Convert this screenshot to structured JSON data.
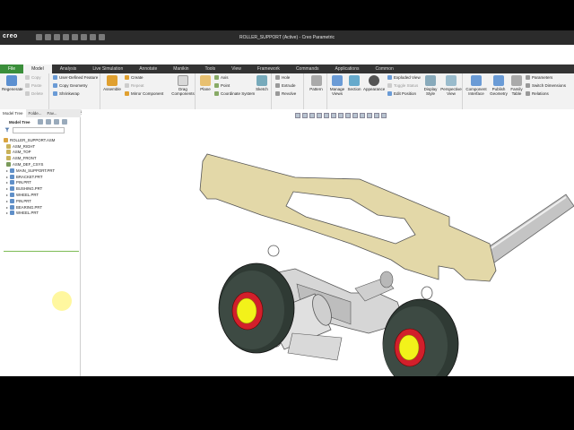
{
  "window": {
    "logo": "creo",
    "title": "ROLLER_SUPPORT (Active) - Creo Parametric"
  },
  "tabs": [
    "File",
    "Model",
    "Analysis",
    "Live Simulation",
    "Annotate",
    "Manikin",
    "Tools",
    "View",
    "Framework",
    "Commands",
    "Applications",
    "Common"
  ],
  "ribbon": {
    "operations": {
      "regenerate": "Regenerate",
      "copy": "Copy",
      "paste": "Paste",
      "delete": "Delete",
      "label": "Operations"
    },
    "get_data": {
      "udf": "User-Defined Feature",
      "copy_geometry": "Copy Geometry",
      "shrinkwrap": "Shrinkwrap",
      "label": "Get Data"
    },
    "component": {
      "assemble": "Assemble",
      "create": "Create",
      "repeat": "Repeat",
      "mirror": "Mirror Component",
      "drag": "Drag Components",
      "label": "Component"
    },
    "datum": {
      "plane": "Plane",
      "axis": "Axis",
      "point": "Point",
      "csys": "Coordinate System",
      "sketch": "Sketch",
      "label": "Datum"
    },
    "cut_surface": {
      "hole": "Hole",
      "extrude": "Extrude",
      "revolve": "Revolve",
      "label": "Cut & Surface"
    },
    "modifiers": {
      "pattern": "Pattern",
      "label": "Modifiers"
    },
    "model_display": {
      "manage_views": "Manage Views",
      "section": "Section",
      "appearance": "Appearance",
      "exploded": "Exploded View",
      "toggle_status": "Toggle Status",
      "edit_position": "Edit Position",
      "display_style": "Display Style",
      "perspective": "Perspective View",
      "label": "Model Display"
    },
    "model_intent": {
      "component_interface": "Component Interface",
      "publish_geometry": "Publish Geometry",
      "family_table": "Family Table",
      "parameters": "Parameters",
      "switch_dimensions": "Switch Dimensions",
      "relations": "Relations",
      "label": "Model Intent"
    }
  },
  "panel": {
    "tabs": [
      "Model Tree",
      "Folde...",
      "Fav..."
    ],
    "tree_label": "Model Tree",
    "search_placeholder": ""
  },
  "tree": [
    {
      "label": "ROLLER_SUPPORT.ASM",
      "icon": "assembly-icon",
      "indent": 0
    },
    {
      "label": "ASM_RIGHT",
      "icon": "datum-plane-icon",
      "indent": 1
    },
    {
      "label": "ASM_TOP",
      "icon": "datum-plane-icon",
      "indent": 1
    },
    {
      "label": "ASM_FRONT",
      "icon": "datum-plane-icon",
      "indent": 1
    },
    {
      "label": "ASM_DEF_CSYS",
      "icon": "csys-icon",
      "indent": 1
    },
    {
      "label": "MAIN_SUPPORT.PRT",
      "icon": "part-icon",
      "indent": 1
    },
    {
      "label": "BRACKET.PRT",
      "icon": "part-icon",
      "indent": 1
    },
    {
      "label": "PIN.PRT",
      "icon": "part-icon",
      "indent": 1
    },
    {
      "label": "BUSHING.PRT",
      "icon": "part-icon",
      "indent": 1
    },
    {
      "label": "WHEEL.PRT",
      "icon": "part-icon",
      "indent": 1
    },
    {
      "label": "PIN.PRT",
      "icon": "part-icon",
      "indent": 1
    },
    {
      "label": "BEARING.PRT",
      "icon": "part-icon",
      "indent": 1
    },
    {
      "label": "WHEEL.PRT",
      "icon": "part-icon",
      "indent": 1
    }
  ],
  "colors": {
    "plate": "#e3d8a8",
    "wheel_tire": "#2f3a34",
    "hub_red": "#d21f2b",
    "hub_yellow": "#f2f21a",
    "axle": "#c8c8c8",
    "file_tab": "#3a8e3a"
  }
}
